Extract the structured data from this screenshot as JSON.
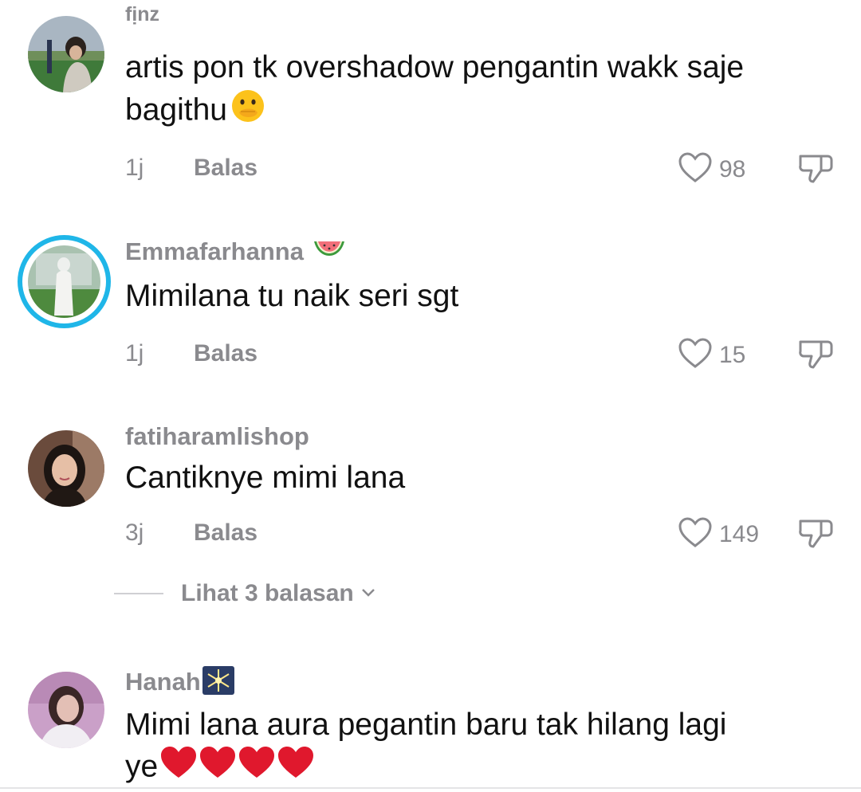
{
  "comments": [
    {
      "username": "fịnz",
      "text": "artis pon tk overshadow pengantin wakk saje bagithu",
      "emoji": "hand-over-mouth-emoji",
      "time": "1j",
      "reply_label": "Balas",
      "likes": "98"
    },
    {
      "username": "Emmafarhanna",
      "username_emoji": "watermelon-emoji",
      "text": "Mimilana tu naik seri sgt",
      "time": "1j",
      "reply_label": "Balas",
      "likes": "15"
    },
    {
      "username": "fatiharamlishop",
      "text": "Cantiknye mimi lana",
      "time": "3j",
      "reply_label": "Balas",
      "likes": "149",
      "view_replies": "Lihat 3 balasan"
    },
    {
      "username": "Hanah",
      "username_emoji": "sparkler-emoji",
      "text_line1": "Mimi lana aura pegantin baru tak hilang lagi",
      "text_line2": "ye",
      "trailing_emoji": "red-heart-emoji x4"
    }
  ],
  "colors": {
    "text": "#111111",
    "muted": "#8a8a8e",
    "story_ring": "#1fb6e8",
    "heart_emoji": "#e0182d"
  }
}
